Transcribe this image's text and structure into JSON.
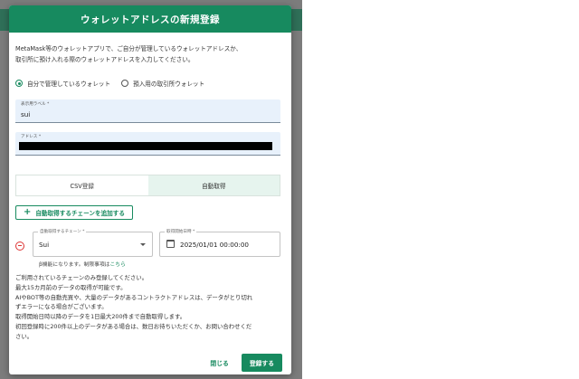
{
  "modal": {
    "title": "ウォレットアドレスの新規登録",
    "description_line1": "MetaMask等のウォレットアプリで、ご自分が管理しているウォレットアドレスか、",
    "description_line2": "取引所に預け入れる際のウォレットアドレスを入力してください。"
  },
  "wallet_type": {
    "options": [
      {
        "label": "自分で管理しているウォレット",
        "selected": true
      },
      {
        "label": "預入用の取引所ウォレット",
        "selected": false
      }
    ]
  },
  "display_label_field": {
    "label": "表示用ラベル *",
    "value": "sui"
  },
  "address_field": {
    "label": "アドレス *",
    "redacted": true
  },
  "tabs": [
    {
      "label": "CSV登録",
      "active": false
    },
    {
      "label": "自動取得",
      "active": true
    }
  ],
  "add_chain_button": {
    "icon": "plus-icon",
    "label": "自動取得するチェーンを追加する"
  },
  "chain_select": {
    "label": "自動取得するチェーン *",
    "value": "Sui"
  },
  "start_date_field": {
    "label": "取得開始日時 *",
    "value": "2025/01/01 00:00:00"
  },
  "beta_note": {
    "text": "β機能になります。制限事項は",
    "link": "こちら"
  },
  "notes": [
    "ご利用されているチェーンのみ登録してください。",
    "最大15カ月前のデータの取得が可能です。",
    "AIやBOT等の自動売買や、大量のデータがあるコントラクトアドレスは、データがとり切れ",
    "ずエラーになる場合がございます。",
    "取得開始日時以降のデータを1日最大200件まで自動取得します。",
    "初回登録時に200件以上のデータがある場合は、数日お待ちいただくか、お問い合わせくだ",
    "さい。"
  ],
  "footer": {
    "close_label": "閉じる",
    "register_label": "登録する"
  },
  "colors": {
    "accent": "#178a5f",
    "field_bg": "#e8f1fb",
    "danger": "#dd3333"
  }
}
